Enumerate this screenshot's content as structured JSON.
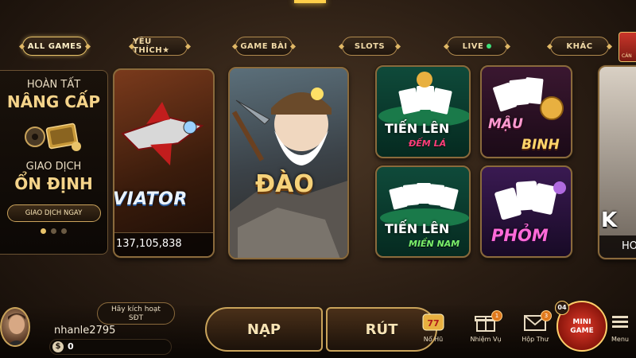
{
  "tabs": [
    {
      "label": "ALL GAMES"
    },
    {
      "label": "YÊU THÍCH★"
    },
    {
      "label": "GAME BÀI"
    },
    {
      "label": "SLOTS"
    },
    {
      "label": "LIVE"
    },
    {
      "label": "KHÁC"
    }
  ],
  "corner_button": {
    "label": "CÁN"
  },
  "promo": {
    "line1": "HOÀN TẤT",
    "line2": "NÂNG CẤP",
    "line3": "GIAO DỊCH",
    "line4": "ỔN ĐỊNH",
    "cta": "GIAO DỊCH NGAY"
  },
  "games": {
    "aviator": {
      "title": "VIATOR",
      "jackpot": "137,105,838"
    },
    "dao": {
      "title": "ĐÀO"
    },
    "tien_len_dem_la": {
      "title": "TIẾN LÊN",
      "sub": "ĐẾM LÁ"
    },
    "mau_binh": {
      "title": "MẬU",
      "sub": "BINH"
    },
    "tien_len_mien_nam": {
      "title": "TIẾN LÊN",
      "sub": "MIỀN NAM"
    },
    "phom": {
      "title": "PHỎM"
    },
    "partial": {
      "title": "K",
      "foot": "HO"
    }
  },
  "user": {
    "activate_prompt_line1": "Hãy kích hoạt",
    "activate_prompt_line2": "SĐT",
    "username": "nhanle2795",
    "currency_symbol": "$",
    "balance": "0"
  },
  "actions": {
    "nap": "NẠP",
    "rut": "RÚT"
  },
  "bottom_menu": [
    {
      "label": "Nổ Hũ",
      "icon": "slot-777-icon"
    },
    {
      "label": "Nhiệm Vụ",
      "icon": "gift-box-icon",
      "badge": "1"
    },
    {
      "label": "Hộp Thư",
      "icon": "envelope-icon",
      "badge": "3"
    },
    {
      "label": "Menu",
      "icon": "hamburger-icon"
    }
  ],
  "mini_game": {
    "line1": "MINI",
    "line2": "GAME",
    "badge": "04"
  }
}
